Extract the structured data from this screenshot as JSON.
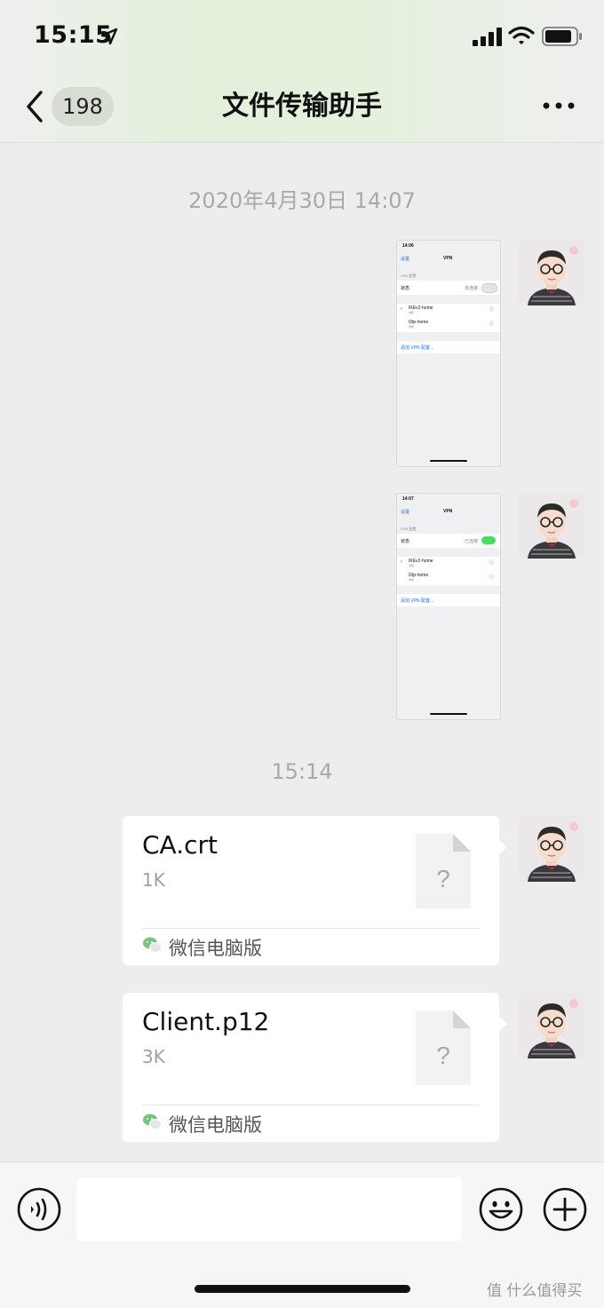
{
  "status_bar": {
    "time": "15:15"
  },
  "nav": {
    "back_count": "198",
    "title": "文件传输助手"
  },
  "timestamps": [
    "2020年4月30日 14:07",
    "15:14"
  ],
  "screenshot_messages": [
    {
      "time": "14:06",
      "back": "设置",
      "title": "VPN",
      "section": "VPN 配置",
      "status_label": "状态",
      "status_value": "未连接",
      "toggle_on": false,
      "configs": [
        {
          "name": "IKEv2-home",
          "sub": "未知"
        },
        {
          "name": "l2tp-home",
          "sub": "未知"
        }
      ],
      "add_link": "添加 VPN 配置..."
    },
    {
      "time": "14:07",
      "back": "设置",
      "title": "VPN",
      "section": "VPN 配置",
      "status_label": "状态",
      "status_value": "已连接",
      "toggle_on": true,
      "configs": [
        {
          "name": "IKEv2-home",
          "sub": "未知"
        },
        {
          "name": "l2tp-home",
          "sub": "未知"
        }
      ],
      "add_link": "添加 VPN 配置..."
    }
  ],
  "file_messages": [
    {
      "name": "CA.crt",
      "size": "1K",
      "source": "微信电脑版"
    },
    {
      "name": "Client.p12",
      "size": "3K",
      "source": "微信电脑版"
    }
  ],
  "watermark": "值 什么值得买",
  "colors": {
    "accent_green": "#4cd964",
    "ios_blue": "#1a73e8",
    "background": "#ededed"
  }
}
